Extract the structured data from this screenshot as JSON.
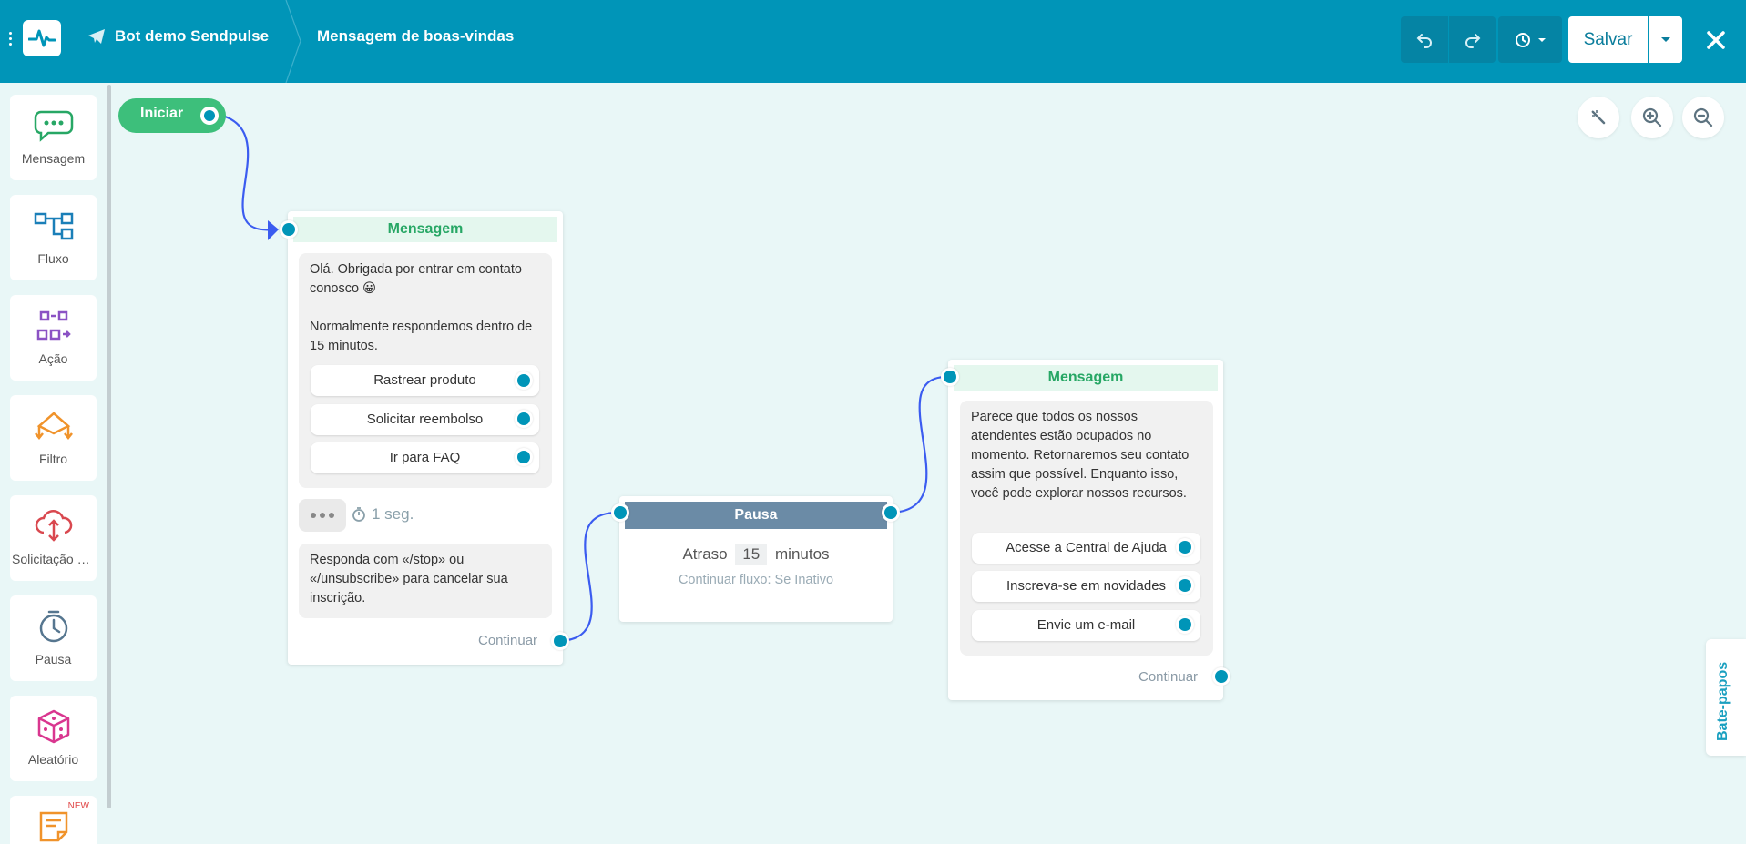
{
  "header": {
    "bot_name": "Bot demo Sendpulse",
    "flow_name": "Mensagem de boas-vindas",
    "save_label": "Salvar",
    "colors": {
      "bar": "#0095b8",
      "button_dark": "#0584a4"
    }
  },
  "sidebar": {
    "items": [
      {
        "label": "Mensagem",
        "icon": "chat-bubble-icon",
        "color": "#27a765"
      },
      {
        "label": "Fluxo",
        "icon": "flow-icon",
        "color": "#1a7fb8"
      },
      {
        "label": "Ação",
        "icon": "action-icon",
        "color": "#8b52c4"
      },
      {
        "label": "Filtro",
        "icon": "filter-icon",
        "color": "#f0932b"
      },
      {
        "label": "Solicitação de API",
        "icon": "api-cloud-icon",
        "color": "#d9484f"
      },
      {
        "label": "Pausa",
        "icon": "clock-icon",
        "color": "#56768f"
      },
      {
        "label": "Aleatório",
        "icon": "dice-icon",
        "color": "#d9368f"
      },
      {
        "label": "",
        "icon": "note-icon",
        "color": "#f0932b",
        "badge": "NEW"
      }
    ]
  },
  "canvas": {
    "start_label": "Iniciar",
    "chat_tab_label": "Bate-papos",
    "node1": {
      "title": "Mensagem",
      "text": "Olá. Obrigada por entrar em contato conosco 😀\n\nNormalmente respondemos dentro de 15 minutos.",
      "buttons": [
        "Rastrear produto",
        "Solicitar reembolso",
        "Ir para FAQ"
      ],
      "typing_time": "1 seg.",
      "text2": "Responda com «/stop» ou «/unsubscribe» para cancelar sua inscrição.",
      "continue_label": "Continuar"
    },
    "pause": {
      "title": "Pausa",
      "prefix": "Atraso",
      "value": "15",
      "unit": "minutos",
      "subtitle": "Continuar fluxo: Se Inativo"
    },
    "node2": {
      "title": "Mensagem",
      "text": "Parece que todos os nossos atendentes estão ocupados no momento. Retornaremos seu contato assim que possível. Enquanto isso, você pode explorar nossos recursos.",
      "buttons": [
        "Acesse a Central de Ajuda",
        "Inscreva-se em novidades",
        "Envie um e-mail"
      ],
      "continue_label": "Continuar"
    }
  }
}
